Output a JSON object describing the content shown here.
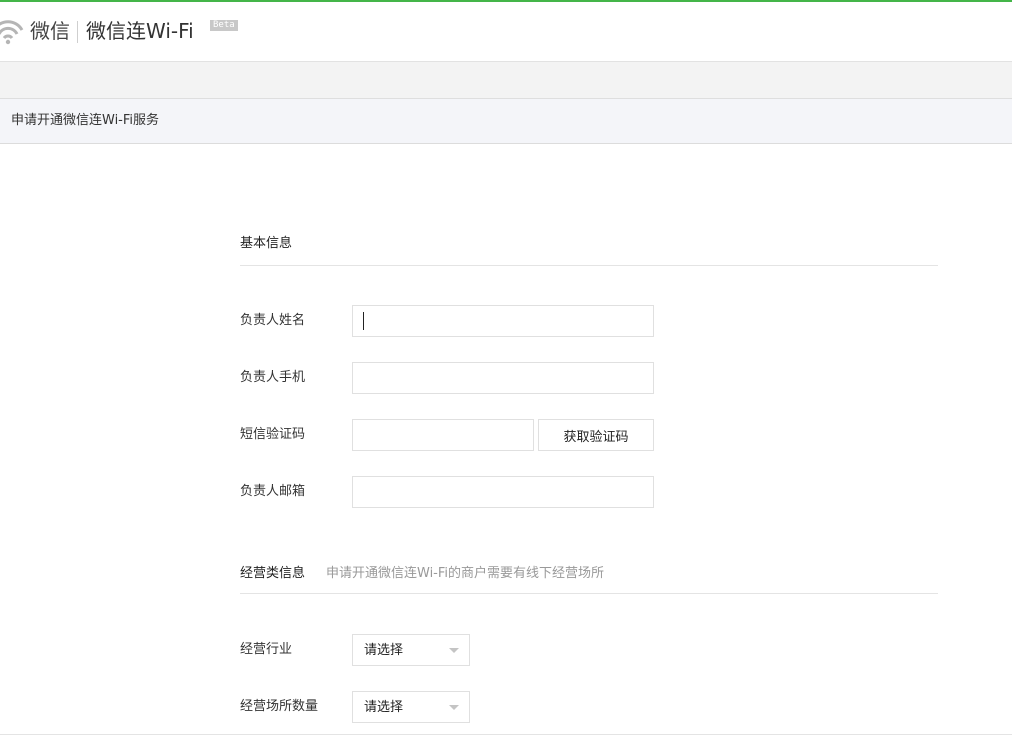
{
  "header": {
    "brand": "微信",
    "product": "微信连Wi-Fi",
    "badge": "Beta",
    "logo_icon": "wifi-icon",
    "accent_color": "#44b549"
  },
  "page": {
    "title": "申请开通微信连Wi-Fi服务"
  },
  "basic_info": {
    "title": "基本信息",
    "fields": [
      {
        "label": "负责人姓名",
        "value": "",
        "placeholder": ""
      },
      {
        "label": "负责人手机",
        "value": "",
        "placeholder": ""
      },
      {
        "label": "短信验证码",
        "value": "",
        "placeholder": ""
      },
      {
        "label": "负责人邮箱",
        "value": "",
        "placeholder": ""
      }
    ],
    "code_button": "获取验证码"
  },
  "business_info": {
    "title": "经营类信息",
    "note": "申请开通微信连Wi-Fi的商户需要有线下经营场所",
    "fields": [
      {
        "label": "经营行业",
        "selected": "请选择"
      },
      {
        "label": "经营场所数量",
        "selected": "请选择"
      }
    ]
  }
}
